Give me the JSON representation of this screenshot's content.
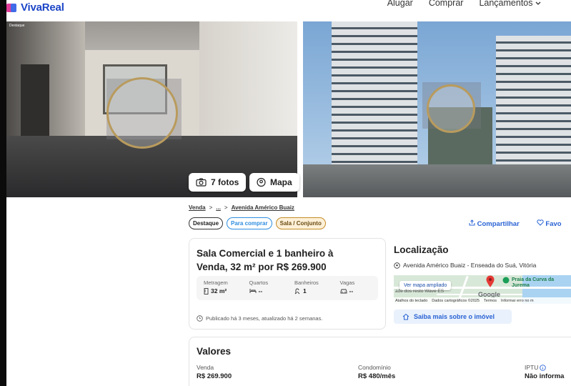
{
  "header": {
    "logo": "VivaReal",
    "nav": [
      "Alugar",
      "Comprar",
      "Lançamentos"
    ],
    "nav_dropdown_icon": "chevron-down-icon"
  },
  "gallery": {
    "tag_small": "Destaque",
    "photos_button": "7 fotos",
    "map_button": "Mapa"
  },
  "breadcrumb": {
    "items": [
      "Venda",
      ">",
      "...",
      ">",
      "Avenida Américo Buaiz"
    ]
  },
  "tags": [
    "Destaque",
    "Para comprar",
    "Sala / Conjunto"
  ],
  "actions": {
    "share": "Compartilhar",
    "favorite": "Favo"
  },
  "listing": {
    "title": "Sala Comercial e 1 banheiro à Venda, 32 m² por R$ 269.900",
    "attributes": [
      {
        "label": "Metragem",
        "value": "32 m²",
        "icon": "ruler-icon"
      },
      {
        "label": "Quartos",
        "value": "--",
        "icon": "bed-icon"
      },
      {
        "label": "Banheiros",
        "value": "1",
        "icon": "shower-icon"
      },
      {
        "label": "Vagas",
        "value": "--",
        "icon": "car-icon"
      }
    ],
    "published": "Publicado há 3 meses, atualizado há 2 semanas."
  },
  "location": {
    "title": "Localização",
    "address": "Avenida Américo Buaiz - Enseada do Suá, Vitória",
    "map": {
      "expand_button": "Ver mapa ampliado",
      "place_label": "Praia da Curva da Jurema",
      "side_label": "ade dos resto Wave ES",
      "google": "Google",
      "footer": [
        "Atalhos do teclado",
        "Dados cartográficos ©2025",
        "Termos",
        "Informar erro no m"
      ]
    },
    "more_button": "Saiba mais sobre o imóvel"
  },
  "values": {
    "title": "Valores",
    "items": [
      {
        "label": "Venda",
        "value": "R$ 269.900"
      },
      {
        "label": "Condomínio",
        "value": "R$ 480/mês"
      },
      {
        "label": "IPTU",
        "value": "Não informa"
      }
    ]
  },
  "colors": {
    "brand_blue": "#1b45c7",
    "link_blue": "#2a63d4",
    "tag_blue": "#2d8de0",
    "tag_gold": "#c48c2a"
  }
}
